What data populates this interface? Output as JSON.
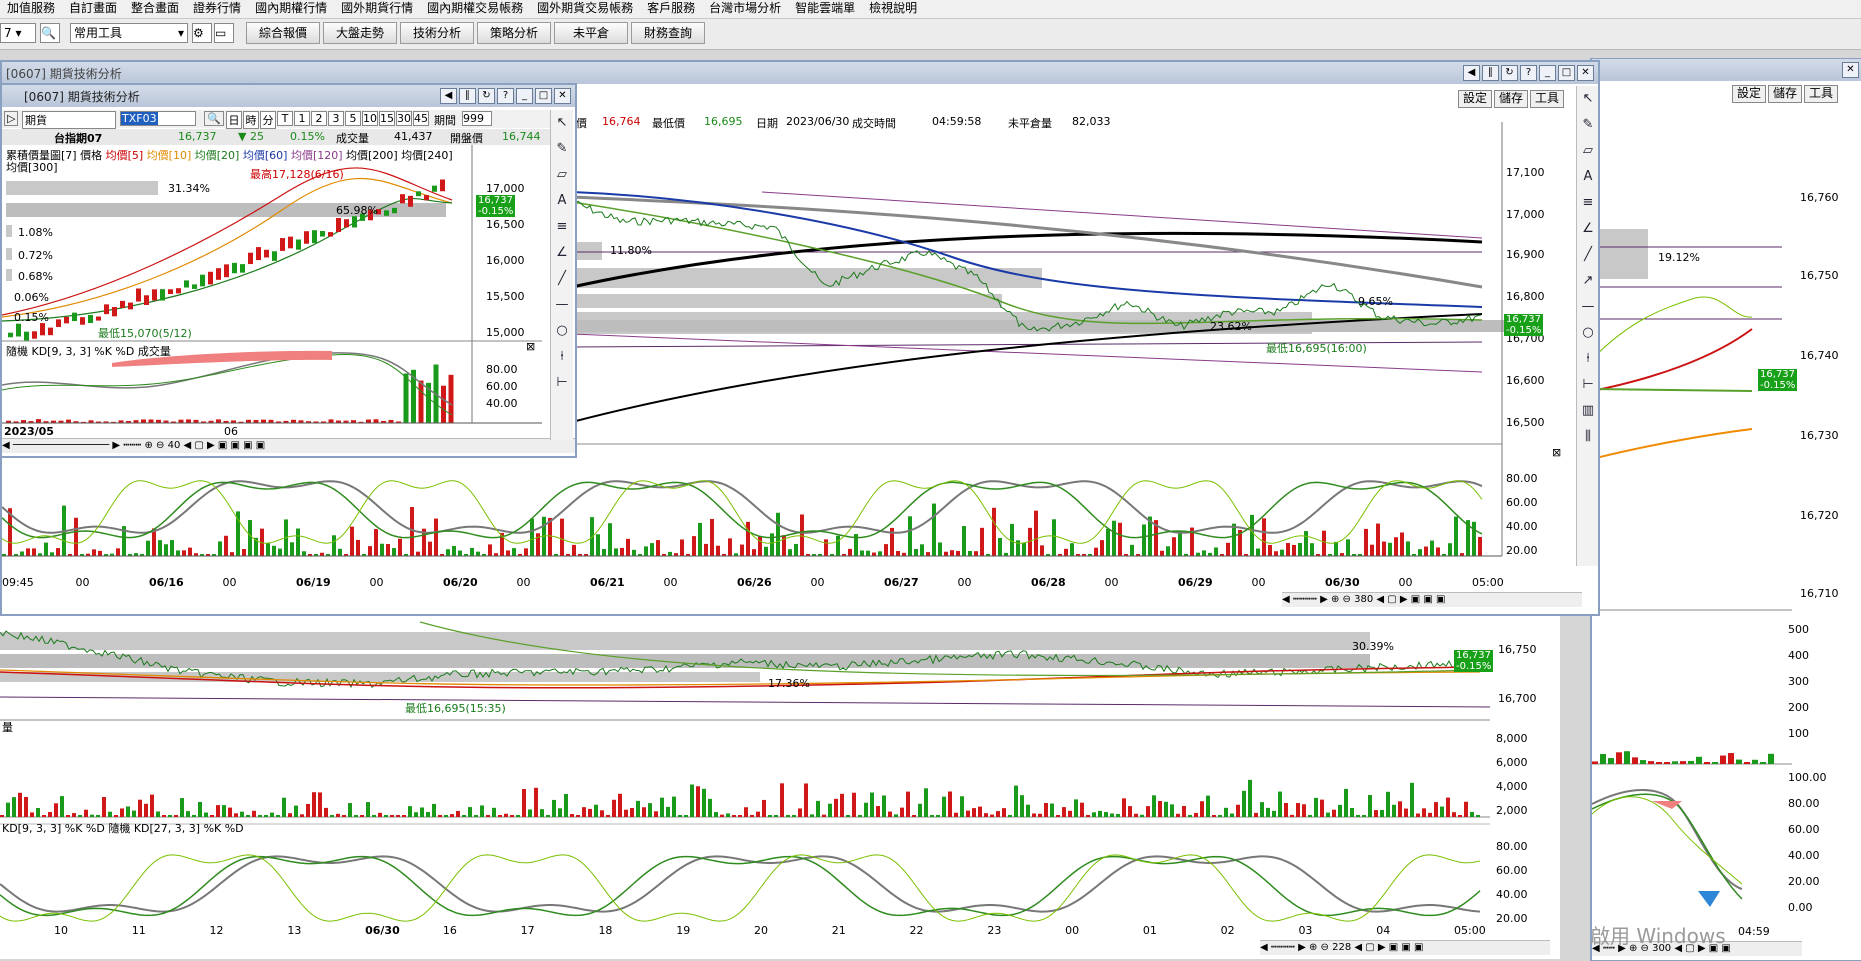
{
  "menu": [
    "加值服務",
    "自訂畫面",
    "整合畫面",
    "證券行情",
    "國內期權行情",
    "國外期貨行情",
    "國內期權交易帳務",
    "國外期貨交易帳務",
    "客戶服務",
    "台灣市場分析",
    "智能雲端單",
    "檢視說明"
  ],
  "toolbar": {
    "combo_left": "7",
    "combo_common": "常用工具",
    "buttons": [
      "綜合報價",
      "大盤走勢",
      "技術分析",
      "策略分析",
      "未平倉",
      "財務查詢"
    ]
  },
  "main_window": {
    "title": "[0607] 期貨技術分析",
    "tools": [
      "設定",
      "儲存",
      "工具"
    ],
    "quote": {
      "high_tail_label": "價",
      "high_value": "16,764",
      "low_label": "最低價",
      "low_value": "16,695",
      "date_label": "日期",
      "date_value": "2023/06/30",
      "time_label": "成交時間",
      "time_value": "04:59:58",
      "oi_label": "未平倉量",
      "oi_value": "82,033"
    },
    "price_axis": [
      "17,100",
      "17,000",
      "16,900",
      "16,800",
      "16,700",
      "16,600",
      "16,500"
    ],
    "pcts": [
      "11.80%",
      "23.62%",
      "9.65%"
    ],
    "low_annot": "最低16,695(16:00)",
    "price_badge": {
      "price": "16,737",
      "change": "-0.15%"
    },
    "kd_axis": [
      "80.00",
      "60.00",
      "40.00",
      "20.00"
    ],
    "dates": [
      "09:45",
      "00",
      "06/16",
      "00",
      "06/19",
      "00",
      "06/20",
      "00",
      "06/21",
      "00",
      "06/26",
      "00",
      "06/27",
      "00",
      "06/28",
      "00",
      "06/29",
      "00",
      "06/30",
      "00",
      "05:00"
    ],
    "nav_count": "380"
  },
  "small_window": {
    "title": "[0607] 期貨技術分析",
    "mode_select": "期貨",
    "symbol": "TXF03",
    "periods": [
      "日",
      "時",
      "分",
      "T",
      "1",
      "2",
      "3",
      "5",
      "10",
      "15",
      "30",
      "45"
    ],
    "period_label": "期間",
    "period_value": "999",
    "row2": {
      "name": "台指期07",
      "price": "16,737",
      "change": "▼ 25",
      "change_pct": "0.15%",
      "vol_label": "成交量",
      "vol": "41,437",
      "open_label": "開盤價",
      "open": "16,744"
    },
    "legend_prefix": "累積價量圖[7] 價格",
    "legend_ma": [
      "均價[5]",
      "均價[10]",
      "均價[20]",
      "均價[60]",
      "均價[120]",
      "均價[200]",
      "均價[240]"
    ],
    "legend_ma2": "均價[300]",
    "high_annot": "最高17,128(6/16)",
    "low_annot": "最低15,070(5/12)",
    "bar_pcts": [
      "31.34%",
      "65.98%",
      "1.08%",
      "0.72%",
      "0.68%",
      "0.06%",
      "0.15%"
    ],
    "price_axis": [
      "17,000",
      "16,500",
      "16,000",
      "15,500",
      "15,000"
    ],
    "price_badge": {
      "price": "16,737",
      "change": "-0.15%"
    },
    "kd_legend": "隨機 KD[9, 3, 3] %K %D 成交量",
    "kd_axis": [
      "80.00",
      "60.00",
      "40.00"
    ],
    "dates": [
      "2023/05",
      "06"
    ],
    "nav_count": "40"
  },
  "bottom_window": {
    "pcts": [
      "30.39%",
      "17.36%"
    ],
    "low_annot": "最低16,695(15:35)",
    "price_axis": [
      "16,750",
      "16,700"
    ],
    "price_badge": {
      "price": "16,737",
      "change": "-0.15%"
    },
    "vol_label": "量",
    "vol_axis": [
      "8,000",
      "6,000",
      "4,000",
      "2,000"
    ],
    "kd_legend": "KD[9, 3, 3] %K %D 隨機 KD[27, 3, 3] %K %D",
    "kd_axis": [
      "80.00",
      "60.00",
      "40.00",
      "20.00"
    ],
    "dates": [
      "10",
      "11",
      "12",
      "13",
      "06/30",
      "16",
      "17",
      "18",
      "19",
      "20",
      "21",
      "22",
      "23",
      "00",
      "01",
      "02",
      "03",
      "04",
      "05:00"
    ],
    "nav_count": "228"
  },
  "right_window": {
    "tools": [
      "設定",
      "儲存",
      "工具"
    ],
    "price_axis": [
      "16,760",
      "16,750",
      "16,740",
      "16,730",
      "16,720",
      "16,710"
    ],
    "pct": "19.12%",
    "price_badge": {
      "price": "16,737",
      "change": "-0.15%"
    },
    "vol_axis": [
      "500",
      "400",
      "300",
      "200",
      "100"
    ],
    "kd_axis": [
      "100.00",
      "80.00",
      "60.00",
      "40.00",
      "20.00",
      "0.00"
    ],
    "time_label": "04:59",
    "nav_count": "300"
  },
  "watermark": "啟用 Windows"
}
